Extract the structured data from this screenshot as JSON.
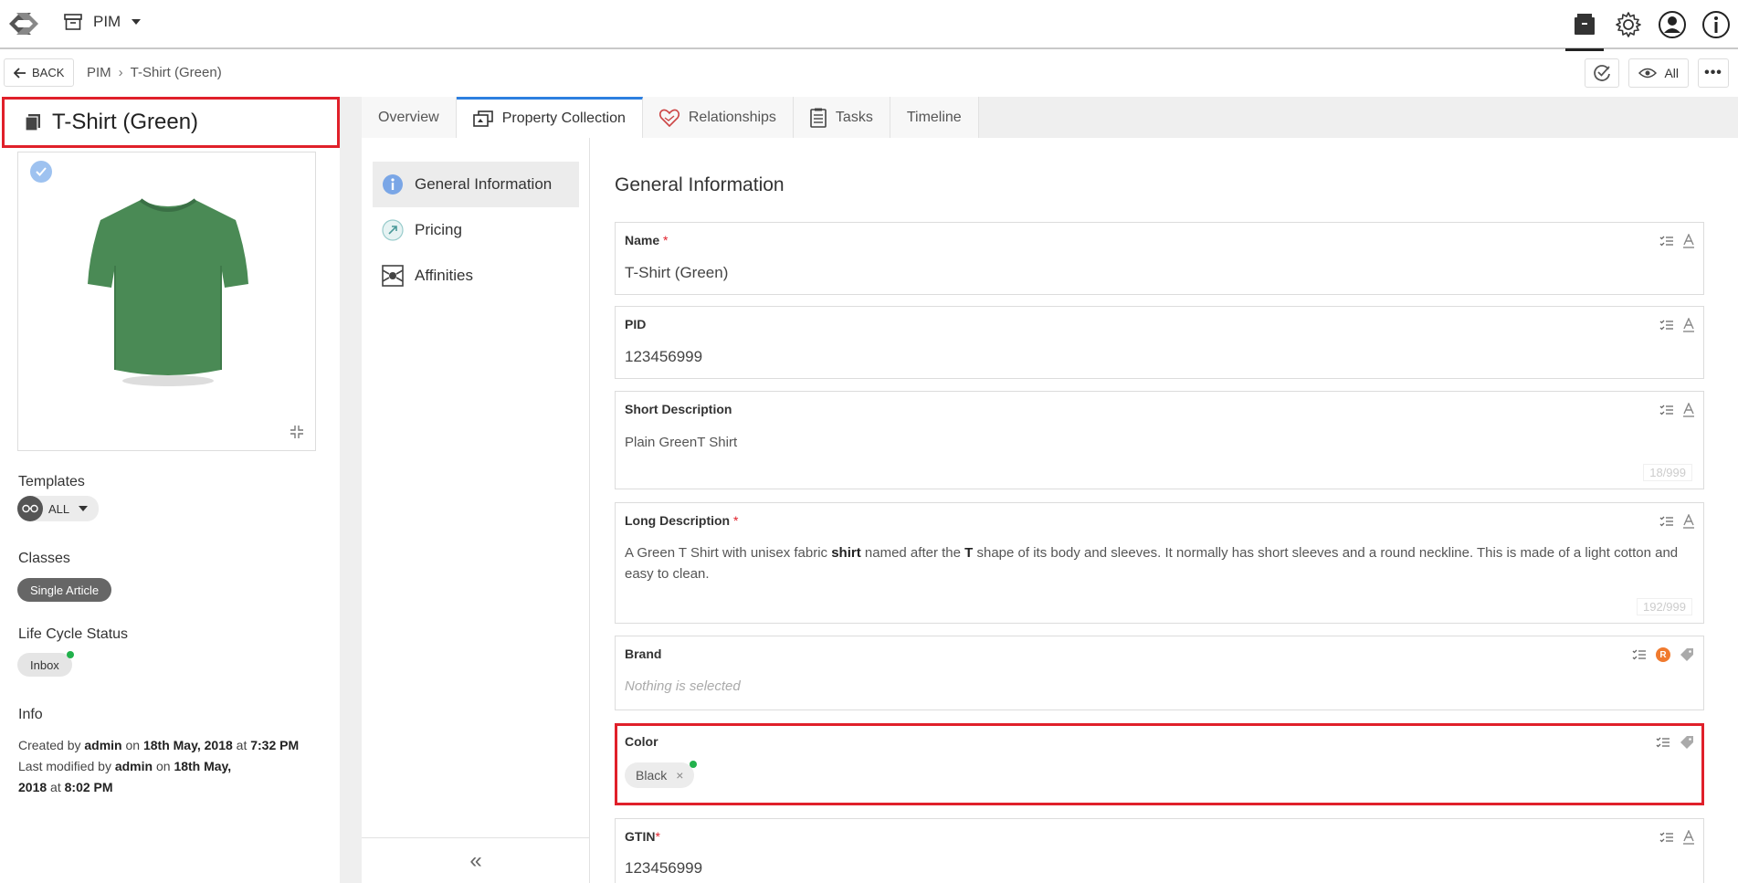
{
  "topbar": {
    "app_label": "PIM"
  },
  "breadcrumb": {
    "back_label": "BACK",
    "items": [
      "PIM",
      "T-Shirt (Green)"
    ],
    "view_filter_label": "All"
  },
  "left": {
    "title": "T-Shirt (Green)",
    "templates_label": "Templates",
    "template_value": "ALL",
    "classes_label": "Classes",
    "class_value": "Single Article",
    "lifecycle_label": "Life Cycle Status",
    "lifecycle_value": "Inbox",
    "info_label": "Info",
    "info": {
      "created_prefix": "Created by",
      "created_user": "admin",
      "created_on": "on",
      "created_date": "18th May, 2018",
      "created_at": "at",
      "created_time": "7:32 PM",
      "modified_prefix": "Last modified by",
      "modified_user": "admin",
      "modified_on": "on",
      "modified_date": "18th May, 2018",
      "modified_at": "at",
      "modified_time": "8:02 PM"
    }
  },
  "tabs": [
    "Overview",
    "Property Collection",
    "Relationships",
    "Tasks",
    "Timeline"
  ],
  "nav": [
    "General Information",
    "Pricing",
    "Affinities"
  ],
  "section_title": "General Information",
  "fields": {
    "name": {
      "label": "Name",
      "value": "T-Shirt (Green)"
    },
    "pid": {
      "label": "PID",
      "value": "123456999"
    },
    "short_desc": {
      "label": "Short Description",
      "value": "Plain GreenT Shirt",
      "counter": "18/999"
    },
    "long_desc": {
      "label": "Long Description",
      "text_1": "A Green T Shirt with unisex fabric ",
      "bold_1": "shirt",
      "text_2": " named after the ",
      "bold_2": "T",
      "text_3": " shape of its body and sleeves. It normally has short sleeves and a round neckline. This is made of a light cotton and easy to clean.",
      "counter": "192/999"
    },
    "brand": {
      "label": "Brand",
      "placeholder": "Nothing is selected",
      "badge": "R"
    },
    "color": {
      "label": "Color",
      "value": "Black",
      "remove": "×"
    },
    "gtin": {
      "label": "GTIN",
      "value": "123456999"
    }
  },
  "required_mark": "*",
  "colors": {
    "highlight": "#e0202a",
    "tab_accent": "#2d7fe0",
    "status_dot": "#22b14c",
    "brand_badge": "#f07a2e"
  }
}
